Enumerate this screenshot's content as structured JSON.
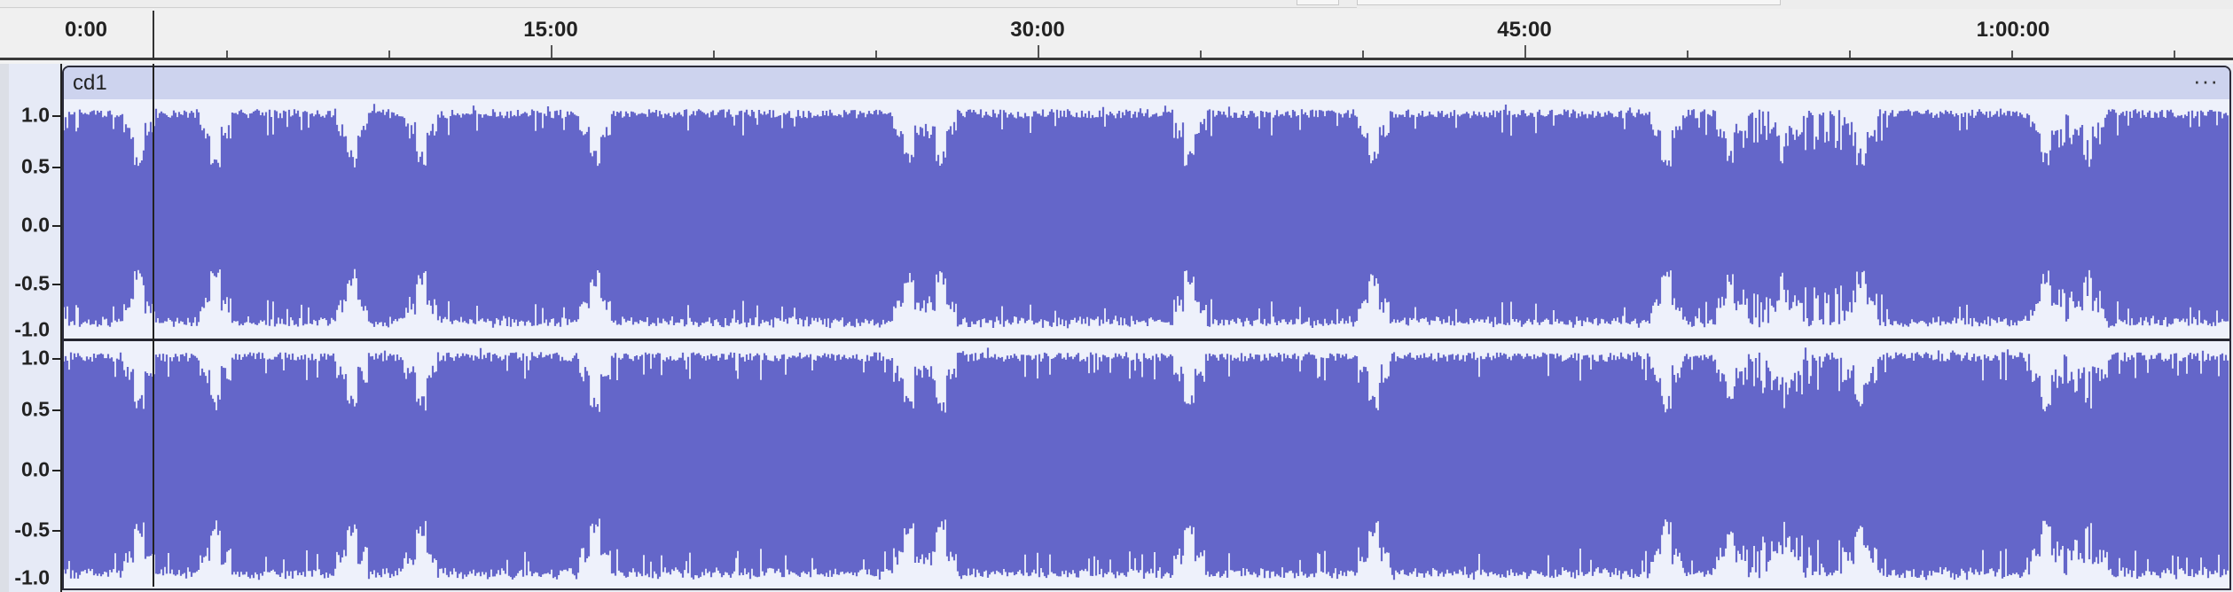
{
  "timeline": {
    "ruler_labels": [
      "0:00",
      "15:00",
      "30:00",
      "45:00",
      "1:00:00"
    ]
  },
  "track": {
    "clip_name": "cd1",
    "clip_menu": "···",
    "amplitude_labels": [
      "1.0",
      "0.5",
      "0.0",
      "-0.5",
      "-1.0"
    ],
    "channels": 2
  },
  "colors": {
    "waveform": "#6466c9",
    "clip_header": "#cdd3ee",
    "clip_background": "#eef1fb",
    "vertical_ruler": "#e6eaf6"
  }
}
